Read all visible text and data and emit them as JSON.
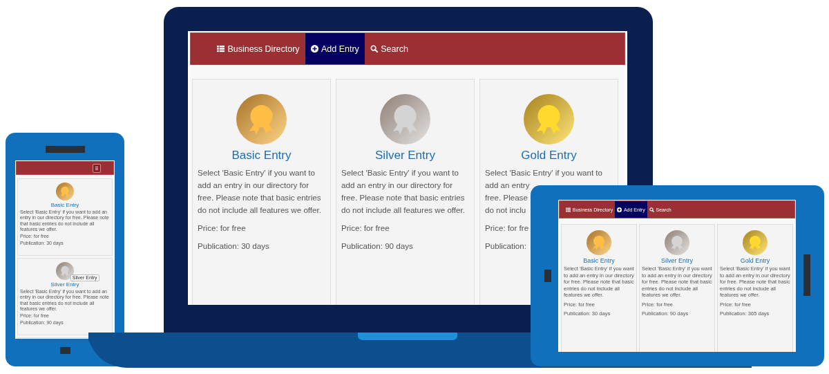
{
  "laptop": {
    "navbar": {
      "kind": "links",
      "items": [
        {
          "label": "Business Directory",
          "selected": false
        },
        {
          "label": "Add Entry",
          "selected": true
        },
        {
          "label": "Search",
          "selected": false
        }
      ]
    },
    "cards": [
      {
        "kind": "full",
        "color": "#ffbf47",
        "title": "Basic Entry",
        "lines": [
          "Select 'Basic Entry' if you want to",
          "add an entry in our directory for",
          "free. Please note that basic entries",
          "do not include all features we offer."
        ],
        "price": "Price: for free",
        "publication": "Publication: 30 days"
      },
      {
        "kind": "full",
        "color": "#d4d4d4",
        "title": "Silver Entry",
        "lines": [
          "Select 'Basic Entry' if you want to",
          "add an entry in our directory for",
          "free. Please note that basic entries",
          "do not include all features we offer."
        ],
        "price": "Price: for free",
        "publication": "Publication: 90 days"
      },
      {
        "kind": "full",
        "color": "#ffd92e",
        "title": "Gold Entry",
        "lines": [
          "Select 'Basic Entry' if you want to",
          "add an entry",
          "free. Please",
          "do not inclu"
        ],
        "price": "Price: for fre",
        "publication": "Publication:"
      }
    ]
  },
  "phone": {
    "navbar": {
      "kind": "toggle"
    },
    "cards": [
      {
        "kind": "full",
        "color": "#ffbf47",
        "title": "Basic Entry",
        "description": "Select 'Basic Entry' if you want to add an entry in our directory for free. Please note that basic entries do not include all features we offer.",
        "price": "Price: for free",
        "publication": "Publication: 30 days"
      },
      {
        "kind": "full",
        "color": "#d4d4d4",
        "title": "Silver Entry",
        "tooltip": "Silver Entry",
        "description": "Select 'Basic Entry' if you want to add an entry in our directory for free. Please note that basic entries do not include all features we offer.",
        "price": "Price: for free",
        "publication": "Publication: 90 days"
      },
      {
        "kind": "edge"
      }
    ]
  },
  "tablet": {
    "navbar": {
      "kind": "links",
      "items": [
        {
          "label": "Business Directory",
          "selected": false
        },
        {
          "label": "Add Entry",
          "selected": true
        },
        {
          "label": "Search",
          "selected": false
        }
      ]
    },
    "cards": [
      {
        "kind": "full",
        "color": "#ffbf47",
        "title": "Basic Entry",
        "description": "Select 'Basic Entry' if you want to add an entry in our directory for free. Please note that basic entries do not include all features we offer.",
        "price": "Price: for free",
        "publication": "Publication: 30 days"
      },
      {
        "kind": "full",
        "color": "#d4d4d4",
        "title": "Silver Entry",
        "description": "Select 'Basic Entry' if you want to add an entry in our directory for free. Please note that basic entries do not include all features we offer.",
        "price": "Price: for free",
        "publication": "Publication: 90 days"
      },
      {
        "kind": "full",
        "color": "#ffd92e",
        "title": "Gold Entry",
        "description": "Select 'Basic Entry' if you want to add an entry in our directory for free. Please note that basic entries do not include all features we offer.",
        "price": "Price: for free",
        "publication": "Publication: 365 days"
      }
    ]
  }
}
